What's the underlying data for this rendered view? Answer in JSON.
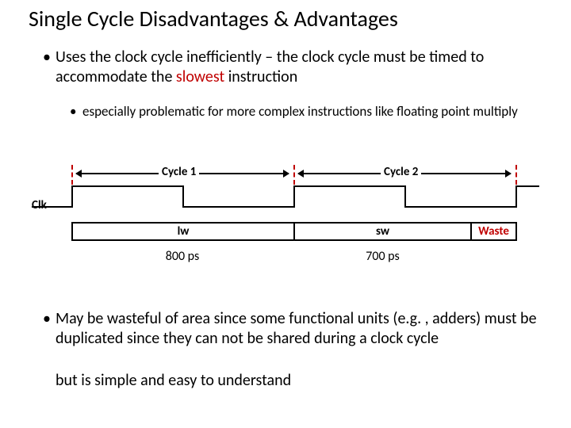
{
  "title": "Single Cycle Disadvantages & Advantages",
  "bullets": {
    "b1_pre": "Uses the clock cycle inefficiently – the clock cycle must be timed to accommodate the ",
    "b1_em": "slowest",
    "b1_post": " instruction",
    "b2": "especially problematic for more complex instructions like floating point multiply",
    "b3_a": "May be wasteful of area since some functional units (e.g. , adders) must be duplicated since they can not be shared during a clock cycle",
    "b3_b": "but is simple and easy to understand"
  },
  "diagram": {
    "clk": "Clk",
    "cycle1": "Cycle 1",
    "cycle2": "Cycle 2",
    "lw": "lw",
    "sw": "sw",
    "waste": "Waste",
    "t_lw": "800 ps",
    "t_sw": "700 ps"
  }
}
